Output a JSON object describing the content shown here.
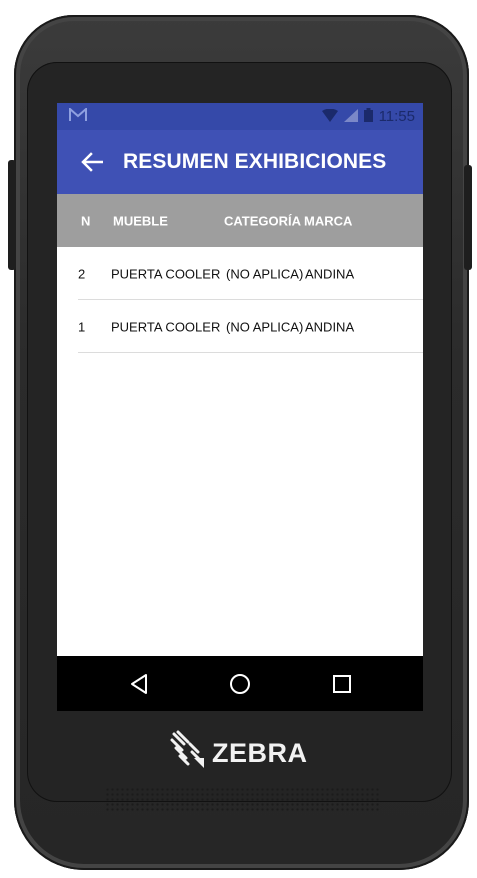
{
  "status_bar": {
    "time": "11:55",
    "notification_icon": "gmail-m-icon"
  },
  "app_bar": {
    "title": "RESUMEN EXHIBICIONES"
  },
  "table": {
    "headers": {
      "n": "N",
      "mueble": "MUEBLE",
      "categoria": "CATEGORÍA",
      "marca": "MARCA"
    },
    "rows": [
      {
        "n": "2",
        "mueble": "PUERTA COOLER",
        "categoria": "(NO APLICA)",
        "marca": "ANDINA"
      },
      {
        "n": "1",
        "mueble": "PUERTA COOLER",
        "categoria": "(NO APLICA)",
        "marca": "ANDINA"
      }
    ]
  },
  "nav_bar": {
    "icons": [
      "back-icon",
      "home-icon",
      "recents-icon"
    ]
  },
  "device": {
    "brand": "ZEBRA"
  },
  "colors": {
    "status_bar": "#3549a9",
    "app_bar": "#3f51b5",
    "table_header": "#9e9e9e"
  }
}
